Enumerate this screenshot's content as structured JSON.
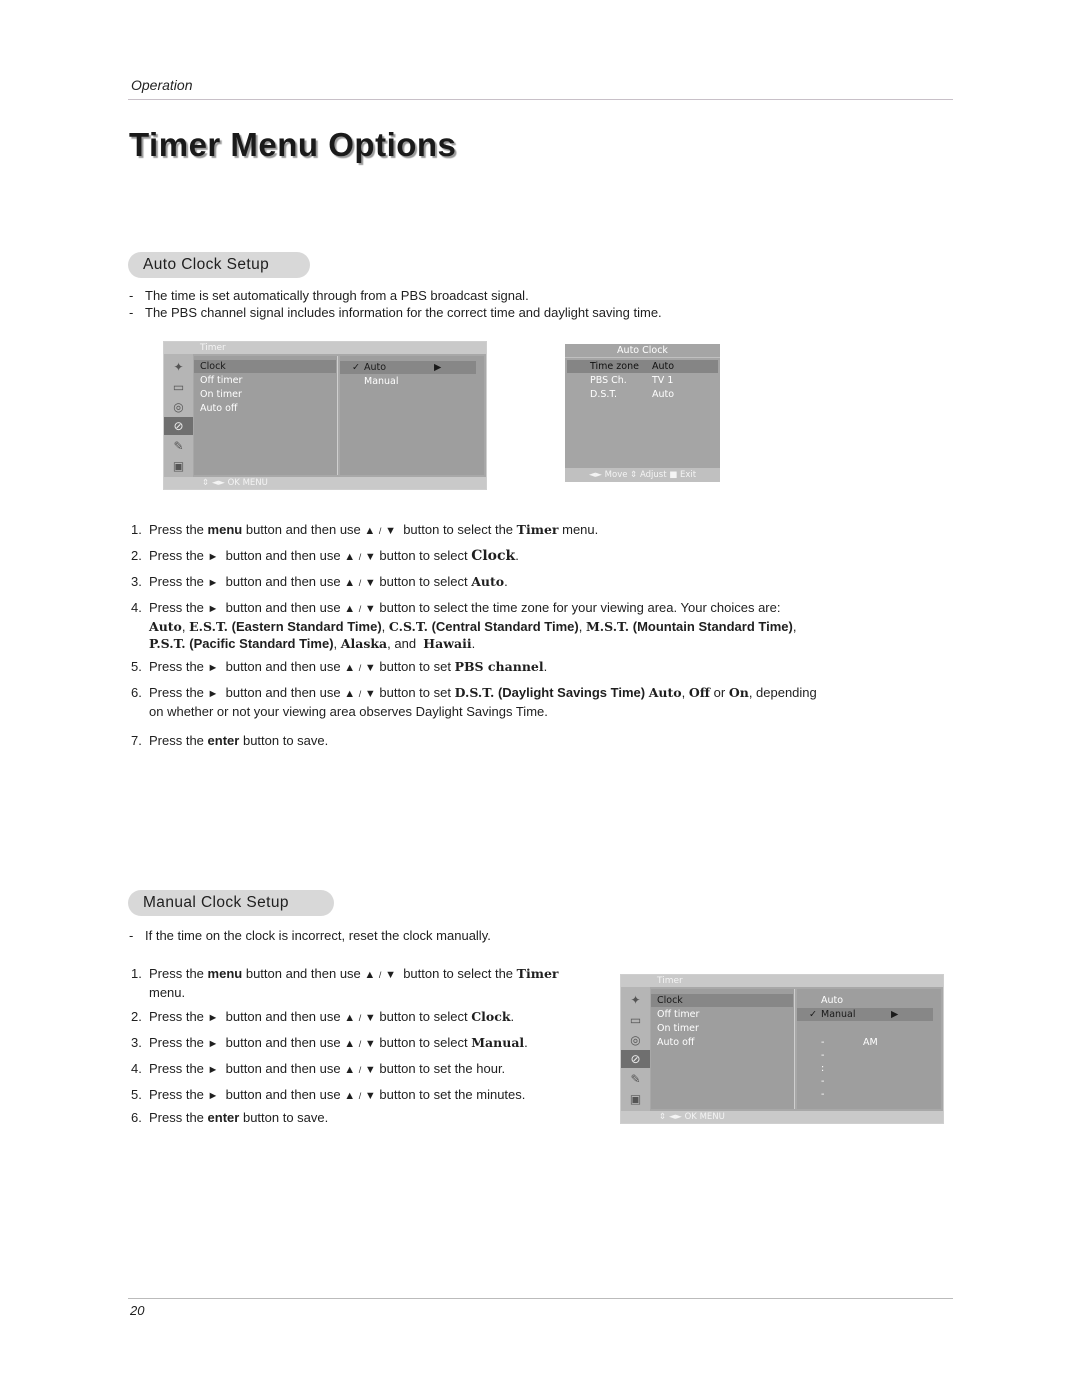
{
  "header": {
    "section": "Operation",
    "title": "Timer Menu Options"
  },
  "auto_clock": {
    "heading": "Auto Clock Setup",
    "bullets": [
      "The time is set automatically through from a PBS broadcast signal.",
      "The PBS channel signal includes information for the correct time and daylight saving time."
    ],
    "timer_menu": {
      "title": "Timer",
      "icons": [
        "satellite-icon",
        "picture-icon",
        "sound-icon",
        "timer-icon",
        "option-icon",
        "lock-icon"
      ],
      "items": [
        "Clock",
        "Off timer",
        "On timer",
        "Auto off"
      ],
      "options": [
        {
          "label": "Auto",
          "checked": true,
          "arrow": "▶"
        },
        {
          "label": "Manual",
          "checked": false
        }
      ],
      "footer": "◄► OK  MENU"
    },
    "auto_clock_menu": {
      "title": "Auto Clock",
      "rows": [
        {
          "key": "Time zone",
          "value": "Auto"
        },
        {
          "key": "PBS Ch.",
          "value": "TV 1"
        },
        {
          "key": "D.S.T.",
          "value": "Auto"
        }
      ],
      "footer": "◄► Move ⇕ Adjust  ■ Exit"
    },
    "steps": [
      {
        "n": "1.",
        "text": "Press the menu button and then use ▲ / ▼ button to select the Timer menu."
      },
      {
        "n": "2.",
        "text": "Press the ► button and then use ▲ / ▼ button to select Clock."
      },
      {
        "n": "3.",
        "text": "Press the ► button and then use ▲ / ▼ button to select Auto."
      },
      {
        "n": "4.",
        "text": "Press the ► button and then use ▲ / ▼ button to select the time zone for your viewing area. Your choices are: Auto, E.S.T. (Eastern Standard Time), C.S.T. (Central Standard Time), M.S.T. (Mountain Standard Time), P.S.T. (Pacific Standard Time), Alaska, and Hawaii."
      },
      {
        "n": "5.",
        "text": "Press the ► button and then use ▲ / ▼ button to set PBS channel."
      },
      {
        "n": "6.",
        "text": "Press the ► button and then use ▲ / ▼ button to set D.S.T. (Daylight Savings Time) Auto, Off or On, depending on whether or not your viewing area observes Daylight Savings Time."
      },
      {
        "n": "7.",
        "text": "Press the enter button to save."
      }
    ]
  },
  "manual_clock": {
    "heading": "Manual Clock Setup",
    "bullets": [
      "If the time on the clock is incorrect, reset the clock manually."
    ],
    "timer_menu": {
      "title": "Timer",
      "items": [
        "Clock",
        "Off timer",
        "On timer",
        "Auto off"
      ],
      "options": [
        {
          "label": "Auto",
          "checked": false
        },
        {
          "label": "Manual",
          "checked": true,
          "arrow": "▶"
        }
      ],
      "time": "- - : - -",
      "ampm": "AM",
      "footer": "◄► OK  MENU"
    },
    "steps": [
      {
        "n": "1.",
        "text": "Press the menu button and then use ▲ / ▼ button to select the Timer menu."
      },
      {
        "n": "2.",
        "text": "Press the ► button and then use ▲ / ▼ button to select Clock."
      },
      {
        "n": "3.",
        "text": "Press the ► button and then use ▲ / ▼ button to select Manual."
      },
      {
        "n": "4.",
        "text": "Press the ► button and then use ▲ / ▼ button to set the hour."
      },
      {
        "n": "5.",
        "text": "Press the ► button and then use ▲ / ▼ button to set the minutes."
      },
      {
        "n": "6.",
        "text": "Press the enter button to save."
      }
    ]
  },
  "footer": {
    "page_number": "20"
  },
  "words": {
    "press_the": "Press the",
    "menu": "menu",
    "enter": "enter",
    "btn_then": "button and then use",
    "up": "▲",
    "slash": "/",
    "down": "▼",
    "right": "►",
    "to_select_the": "button to select the",
    "to_select": "button to select",
    "to_set": "button to set",
    "timer": "Timer",
    "menu_word": "menu.",
    "clock": "Clock",
    "auto": "Auto",
    "manual": "Manual",
    "choices": "button to select the time zone for your viewing area. Your choices are:",
    "est": "E.S.T.",
    "est_l": "(Eastern Standard Time)",
    "cst": "C.S.T.",
    "cst_l": "(Central Standard Time)",
    "mst": "M.S.T.",
    "mst_l": "(Mountain  Standard Time)",
    "pst": "P.S.T.",
    "pst_l": "(Pacific Standard Time)",
    "alaska": "Alaska",
    "and": ", and",
    "hawaii": "Hawaii",
    "pbs": "PBS channel",
    "dst": "D.S.T.",
    "dst_l": "(Daylight Savings Time)",
    "off": "Off",
    "or": "or",
    "on": "On",
    "depending": ", depending",
    "observes": "on whether or not your viewing area observes Daylight Savings Time.",
    "save": "button to save.",
    "hour": "button to set the hour.",
    "minutes": "button to set the minutes."
  }
}
